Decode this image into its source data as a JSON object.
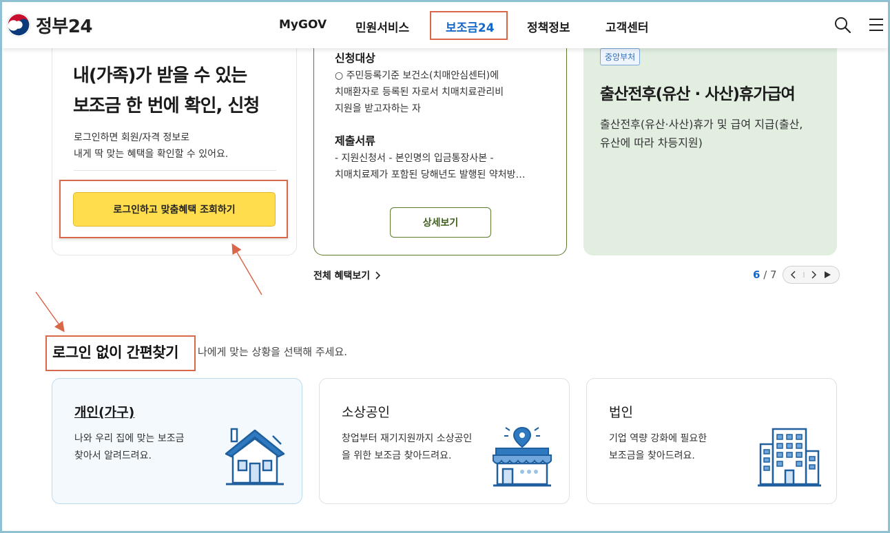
{
  "header": {
    "logo_text": "정부24",
    "nav": [
      "MyGOV",
      "민원서비스",
      "보조금24",
      "정책정보",
      "고객센터"
    ],
    "active_nav": "보조금24"
  },
  "login_card": {
    "title_line1": "내(가족)가 받을 수 있는",
    "title_line2": "보조금 한 번에 확인, 신청",
    "desc_line1": "로그인하면 회원/자격 정보로",
    "desc_line2": "내게 딱 맞는 혜택을 확인할 수 있어요.",
    "button": "로그인하고 맞춤혜택 조회하기"
  },
  "benefit_card": {
    "target_heading": "신청대상",
    "target_line1": "○ 주민등록기준 보건소(치매안심센터)에",
    "target_line2": "치매환자로 등록된 자로서 치매치료관리비",
    "target_line3": "지원을 받고자하는 자",
    "docs_heading": "제출서류",
    "docs_line1": "- 지원신청서 - 본인명의 입금통장사본 -",
    "docs_line2": "치매치료제가 포함된 당해년도 발행된 약처방…",
    "detail_button": "상세보기"
  },
  "green_card": {
    "tag": "중앙부처",
    "title": "출산전후(유산 · 사산)휴가급여",
    "desc_line1": "출산전후(유산·사산)휴가 및 급여 지급(출산,",
    "desc_line2": "유산에 따라 차등지원)"
  },
  "carousel": {
    "all_link": "전체 혜택보기",
    "current": "6",
    "separator": " / ",
    "total": "7"
  },
  "section": {
    "title": "로그인 없이 간편찾기",
    "subtitle": "나에게 맞는 상황을 선택해 주세요."
  },
  "categories": [
    {
      "title": "개인(가구)",
      "desc_line1": "나와 우리 집에 맞는 보조금",
      "desc_line2": "찾아서 알려드려요."
    },
    {
      "title": "소상공인",
      "desc_line1": "창업부터 재기지원까지 소상공인",
      "desc_line2": "을 위한 보조금 찾아드려요."
    },
    {
      "title": "법인",
      "desc_line1": "기업 역량 강화에 필요한",
      "desc_line2": "보조금을 찾아드려요."
    }
  ],
  "colors": {
    "accent_blue": "#1668c8",
    "highlight_red": "#d9674a",
    "login_yellow": "#ffdd4d",
    "card_green": "#e1eee0",
    "icon_blue": "#1f5f9e"
  },
  "icons": [
    "search-icon",
    "menu-icon",
    "house-icon",
    "store-icon",
    "building-icon",
    "chevron-right-icon",
    "play-icon"
  ]
}
